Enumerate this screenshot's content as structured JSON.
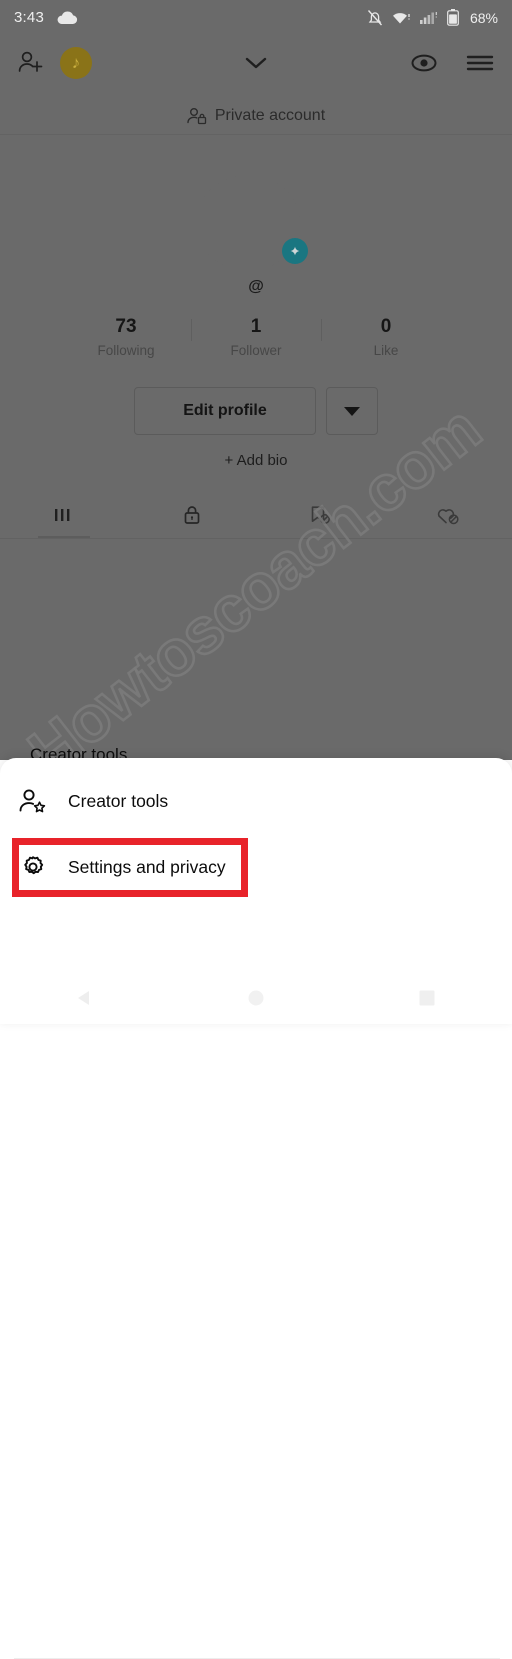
{
  "status_bar": {
    "time": "3:43",
    "battery_percent": "68%",
    "icons": [
      "cloud-icon",
      "notification-muted-icon",
      "wifi-icon",
      "cellular-signal-icon",
      "battery-icon"
    ]
  },
  "profile_header": {
    "add_friends_icon": "add-person-icon",
    "avatar_badge_glyph": "♪",
    "chevron_icon": "chevron-down-icon",
    "eye_icon": "eye-icon",
    "menu_icon": "hamburger-menu-icon"
  },
  "private_account": {
    "label": "Private account",
    "icon": "person-lock-icon"
  },
  "profile": {
    "handle": "@",
    "avatar_add_icon": "plus-icon",
    "accent_teal": "#1a7681",
    "badge_gold": "#8a7318"
  },
  "stats": [
    {
      "value": "73",
      "label": "Following"
    },
    {
      "value": "1",
      "label": "Follower"
    },
    {
      "value": "0",
      "label": "Like"
    }
  ],
  "actions": {
    "edit_profile_label": "Edit profile",
    "more_icon": "caret-down-icon",
    "add_bio_label": "+ Add bio"
  },
  "tabs": [
    {
      "name": "videos",
      "icon": "grid-icon"
    },
    {
      "name": "private",
      "icon": "lock-icon"
    },
    {
      "name": "saved",
      "icon": "bookmark-hidden-icon"
    },
    {
      "name": "liked",
      "icon": "heart-hidden-icon"
    }
  ],
  "watermark": {
    "text": "Howtoscoach.com"
  },
  "bottom_sheet": {
    "cut_off_row_label": "Creator tools",
    "items": [
      {
        "label": "Creator tools",
        "icon": "person-star-icon"
      },
      {
        "label": "Settings and privacy",
        "icon": "gear-icon"
      }
    ],
    "highlight_color": "#e8232a",
    "highlighted_item": "Settings and privacy"
  },
  "nav_bar": {
    "back_icon": "back-triangle-icon",
    "home_icon": "home-circle-icon",
    "recents_icon": "recents-square-icon"
  }
}
